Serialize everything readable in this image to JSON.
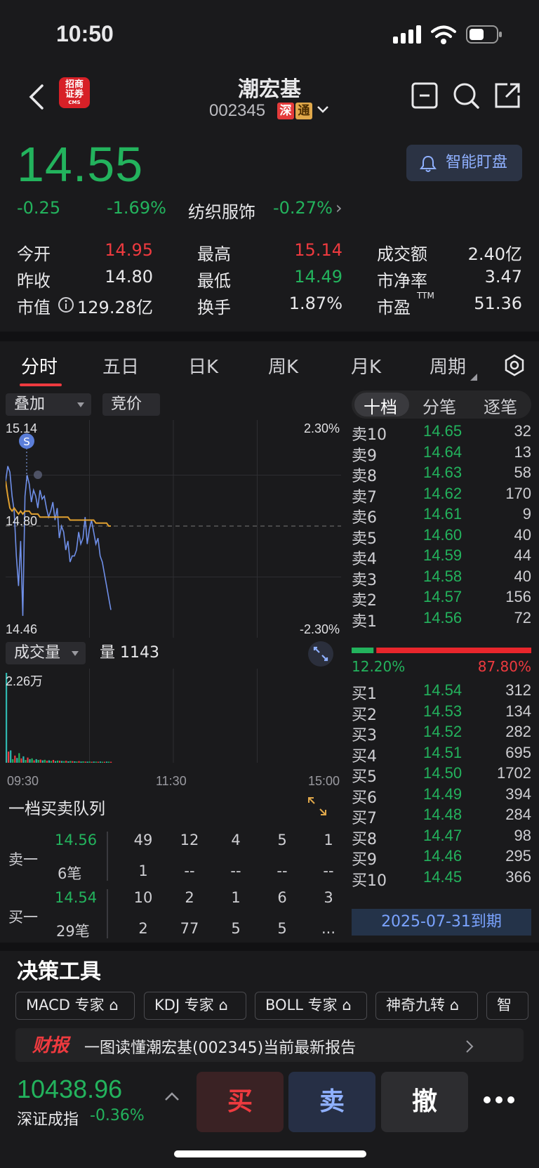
{
  "status_bar": {
    "time": "10:50"
  },
  "header": {
    "logo_line1": "招商",
    "logo_line2": "证券",
    "logo_sub": "CMS",
    "name": "潮宏基",
    "code": "002345",
    "tag1": "深",
    "tag2": "通"
  },
  "quote": {
    "price": "14.55",
    "change": "-0.25",
    "change_pct": "-1.69%",
    "sector": "纺织服饰",
    "sector_pct": "-0.27%",
    "sector_arrow": "›",
    "smart_watch": "智能盯盘",
    "stats": [
      {
        "label": "今开",
        "value": "14.95"
      },
      {
        "label": "最高",
        "value": "15.14"
      },
      {
        "label": "成交额",
        "value": "2.40亿"
      },
      {
        "label": "昨收",
        "value": "14.80"
      },
      {
        "label": "最低",
        "value": "14.49"
      },
      {
        "label": "市净率",
        "value": "3.47"
      },
      {
        "label": "市值",
        "value": "129.28亿"
      },
      {
        "label": "换手",
        "value": "1.87%"
      },
      {
        "label": "市盈",
        "sup": "TTM",
        "value": "51.36"
      }
    ]
  },
  "tabs": [
    "分时",
    "五日",
    "日K",
    "周K",
    "月K",
    "周期"
  ],
  "chart_controls": {
    "overlay": "叠加",
    "auction": "竞价",
    "volume": "成交量",
    "volume_value": "量 1143"
  },
  "chart_data": {
    "type": "line",
    "y_left_ticks": [
      "15.14",
      "14.80",
      "14.46"
    ],
    "y_right_ticks": [
      "2.30%",
      "-2.30%"
    ],
    "ylim": [
      14.46,
      15.14
    ],
    "prev_close": 14.8,
    "marker": "S",
    "series": [
      {
        "values": [
          14.95,
          15.0,
          14.98,
          14.9,
          14.85,
          14.7,
          14.6,
          14.75,
          14.5,
          14.9,
          14.97,
          14.94,
          14.88,
          14.92,
          14.9,
          14.86,
          14.92,
          14.89,
          14.9,
          14.86,
          14.83,
          14.85,
          14.88,
          14.82,
          14.86,
          14.76,
          14.8,
          14.78,
          14.72,
          14.75,
          14.68,
          14.7,
          14.7,
          14.72,
          14.78,
          14.74,
          14.76,
          14.83,
          14.74,
          14.79,
          14.82,
          14.78,
          14.74,
          14.76,
          14.7,
          14.68,
          14.64,
          14.6,
          14.56,
          14.52
        ]
      },
      {
        "values": [
          14.95,
          14.9,
          14.86,
          14.85,
          14.86,
          14.85,
          14.84,
          14.85,
          14.84,
          14.85,
          14.85,
          14.85,
          14.84,
          14.84,
          14.84,
          14.84,
          14.83,
          14.83,
          14.83,
          14.83,
          14.83,
          14.83,
          14.83,
          14.83,
          14.83,
          14.83,
          14.83,
          14.83,
          14.83,
          14.83,
          14.82,
          14.82,
          14.82,
          14.82,
          14.82,
          14.82,
          14.82,
          14.82,
          14.82,
          14.82,
          14.82,
          14.82,
          14.81,
          14.81,
          14.81,
          14.81,
          14.81,
          14.81,
          14.8,
          14.8
        ]
      }
    ],
    "volume_label": "2.26万",
    "x_ticks": [
      "09:30",
      "11:30",
      "15:00"
    ],
    "volume_values": [
      22600,
      2800,
      3100,
      900,
      1800,
      1200,
      2400,
      1100,
      1600,
      700,
      1300,
      900,
      1100,
      600,
      900,
      700,
      800,
      600,
      750,
      500,
      600,
      450,
      700,
      400,
      550,
      500,
      450,
      400,
      500,
      350,
      450,
      400,
      350,
      300,
      400,
      300,
      350,
      300,
      280,
      300,
      250,
      300,
      280,
      260,
      300,
      250,
      240,
      280,
      260,
      250
    ]
  },
  "order_book": {
    "tabs": [
      "十档",
      "分笔",
      "逐笔"
    ],
    "asks": [
      {
        "label": "卖10",
        "price": "14.65",
        "vol": "32"
      },
      {
        "label": "卖9",
        "price": "14.64",
        "vol": "13"
      },
      {
        "label": "卖8",
        "price": "14.63",
        "vol": "58"
      },
      {
        "label": "卖7",
        "price": "14.62",
        "vol": "170"
      },
      {
        "label": "卖6",
        "price": "14.61",
        "vol": "9"
      },
      {
        "label": "卖5",
        "price": "14.60",
        "vol": "40"
      },
      {
        "label": "卖4",
        "price": "14.59",
        "vol": "44"
      },
      {
        "label": "卖3",
        "price": "14.58",
        "vol": "40"
      },
      {
        "label": "卖2",
        "price": "14.57",
        "vol": "156"
      },
      {
        "label": "卖1",
        "price": "14.56",
        "vol": "72"
      }
    ],
    "buy_ratio": "12.20%",
    "sell_ratio": "87.80%",
    "buy_fraction": 0.122,
    "bids": [
      {
        "label": "买1",
        "price": "14.54",
        "vol": "312"
      },
      {
        "label": "买2",
        "price": "14.53",
        "vol": "134"
      },
      {
        "label": "买3",
        "price": "14.52",
        "vol": "282"
      },
      {
        "label": "买4",
        "price": "14.51",
        "vol": "695"
      },
      {
        "label": "买5",
        "price": "14.50",
        "vol": "1702"
      },
      {
        "label": "买6",
        "price": "14.49",
        "vol": "394"
      },
      {
        "label": "买7",
        "price": "14.48",
        "vol": "284"
      },
      {
        "label": "买8",
        "price": "14.47",
        "vol": "98"
      },
      {
        "label": "买9",
        "price": "14.46",
        "vol": "295"
      },
      {
        "label": "买10",
        "price": "14.45",
        "vol": "366"
      }
    ],
    "expiry": "2025-07-31到期"
  },
  "queue": {
    "title": "一档买卖队列",
    "sell_label": "卖一",
    "sell_price": "14.56",
    "sell_count": "6笔",
    "sell_row1": [
      "49",
      "12",
      "4",
      "5",
      "1"
    ],
    "sell_row2": [
      "1",
      "--",
      "--",
      "--",
      "--"
    ],
    "buy_label": "买一",
    "buy_price": "14.54",
    "buy_count": "29笔",
    "buy_row1": [
      "10",
      "2",
      "1",
      "6",
      "3"
    ],
    "buy_row2": [
      "2",
      "77",
      "5",
      "5",
      "..."
    ]
  },
  "tools": {
    "title": "决策工具",
    "items": [
      "MACD 专家",
      "KDJ 专家",
      "BOLL 专家",
      "神奇九转",
      "智"
    ]
  },
  "report": {
    "badge": "财报",
    "text": "一图读懂潮宏基(002345)当前最新报告"
  },
  "bottom": {
    "index_value": "10438.96",
    "index_name": "深证成指",
    "index_change": "-0.36%",
    "buy": "买",
    "sell": "卖",
    "cancel": "撤"
  },
  "colors": {
    "up": "#ee3a3f",
    "down": "#23b35d",
    "accent": "#8fb0ff"
  }
}
